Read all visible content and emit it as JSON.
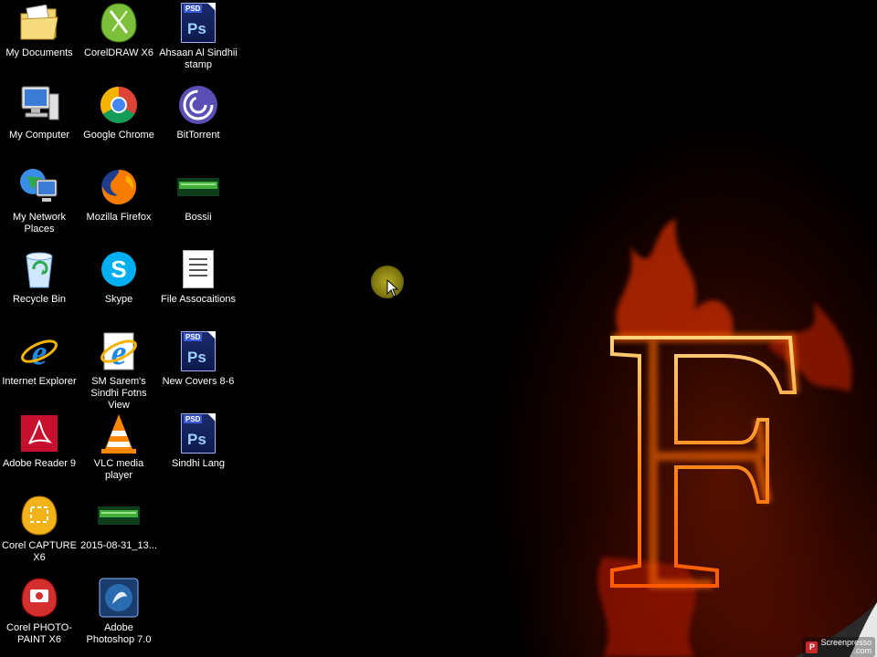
{
  "desktop": {
    "icons": [
      {
        "label": "My Documents",
        "icon": "folder-documents-icon"
      },
      {
        "label": "CorelDRAW X6",
        "icon": "coreldraw-icon"
      },
      {
        "label": "Ahsaan Al Sindhii stamp",
        "icon": "psd-file-icon"
      },
      {
        "label": "My Computer",
        "icon": "computer-icon"
      },
      {
        "label": "Google Chrome",
        "icon": "chrome-icon"
      },
      {
        "label": "BitTorrent",
        "icon": "bittorrent-icon"
      },
      {
        "label": "My Network Places",
        "icon": "network-places-icon"
      },
      {
        "label": "Mozilla Firefox",
        "icon": "firefox-icon"
      },
      {
        "label": "Bossii",
        "icon": "image-file-icon"
      },
      {
        "label": "Recycle Bin",
        "icon": "recycle-bin-icon"
      },
      {
        "label": "Skype",
        "icon": "skype-icon"
      },
      {
        "label": "File Assocaitions",
        "icon": "text-file-icon"
      },
      {
        "label": "Internet Explorer",
        "icon": "internet-explorer-icon"
      },
      {
        "label": "SM Sarem's Sindhi Fotns View",
        "icon": "ie-shortcut-icon"
      },
      {
        "label": "New Covers 8-6",
        "icon": "psd-file-icon"
      },
      {
        "label": "Adobe Reader 9",
        "icon": "adobe-reader-icon"
      },
      {
        "label": "VLC media player",
        "icon": "vlc-icon"
      },
      {
        "label": "Sindhi Lang",
        "icon": "psd-file-icon"
      },
      {
        "label": "Corel CAPTURE X6",
        "icon": "corel-capture-icon"
      },
      {
        "label": "2015-08-31_13...",
        "icon": "image-file-icon"
      },
      {
        "label": "Corel PHOTO-PAINT X6",
        "icon": "corel-photopaint-icon"
      },
      {
        "label": "Adobe Photoshop 7.0",
        "icon": "photoshop-icon"
      }
    ]
  },
  "psd_tag": "PSD",
  "ps_text": "Ps",
  "wallpaper": {
    "letter": "F"
  },
  "watermark": {
    "brand": "Screenpresso",
    "domain": ".com",
    "logo_letter": "P"
  },
  "colors": {
    "fire_orange": "#ff8a1a",
    "fire_red": "#b81e00",
    "cursor_halo": "#b4a82a"
  }
}
